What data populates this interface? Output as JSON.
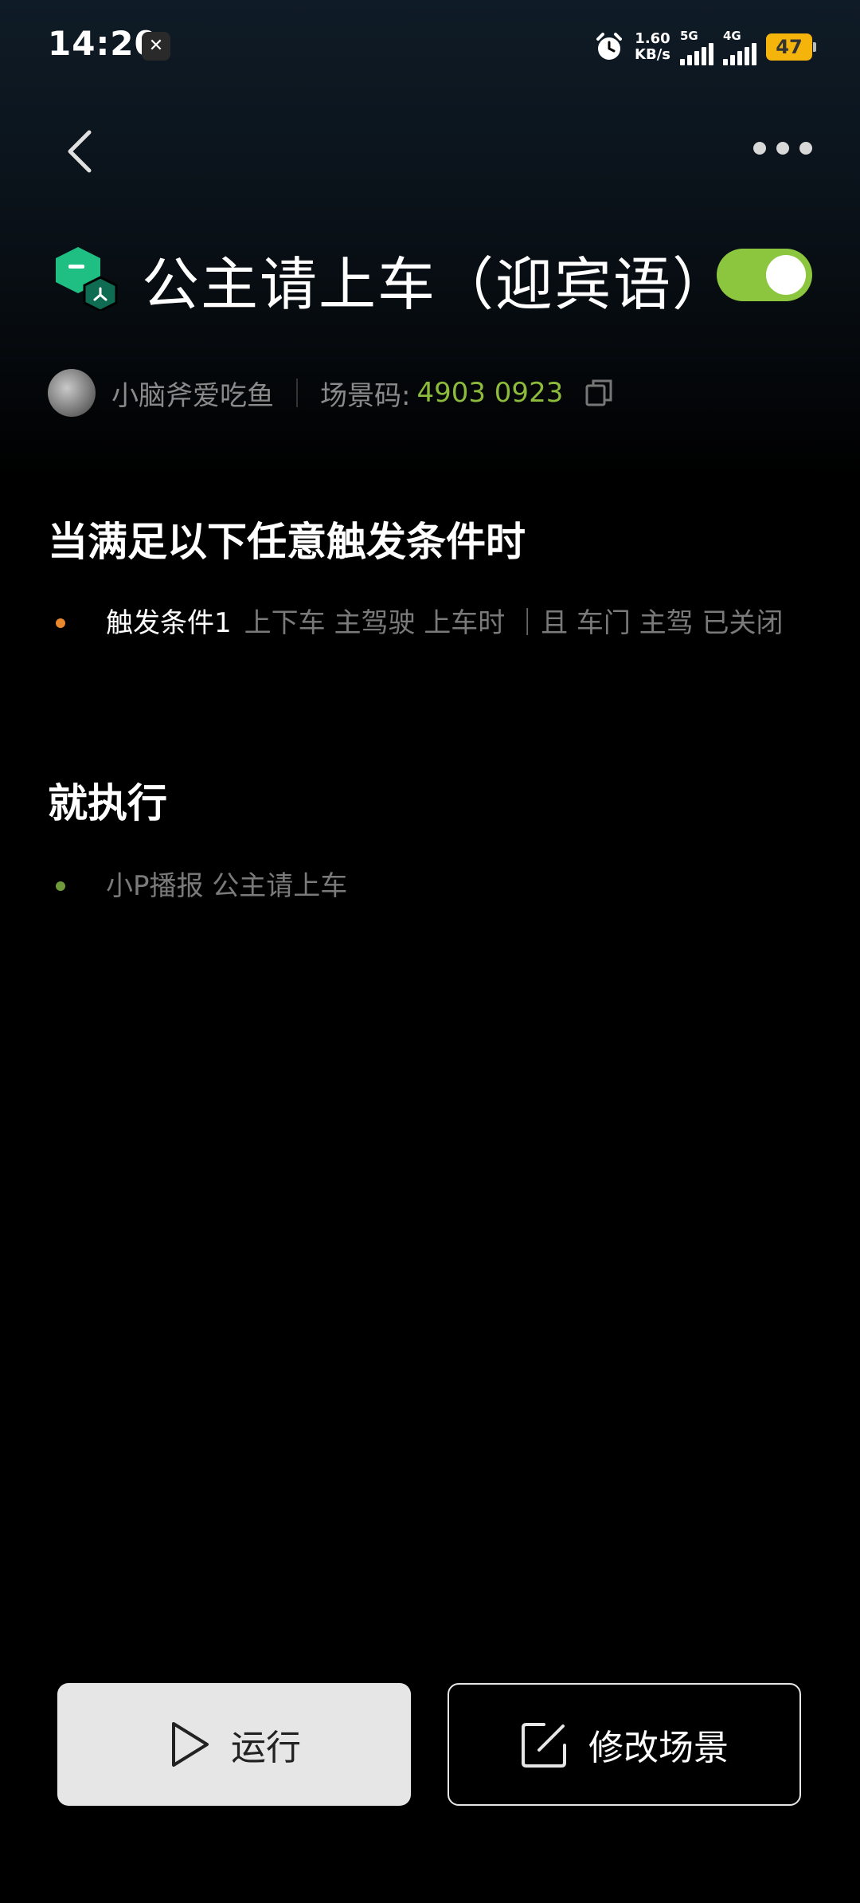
{
  "status_bar": {
    "time": "14:20",
    "net_speed_value": "1.60",
    "net_speed_unit": "KB/s",
    "signal1_label": "5G",
    "signal2_label": "4G",
    "battery": "47"
  },
  "header": {
    "title": "公主请上车（迎宾语）",
    "enabled": true
  },
  "author": {
    "name": "小脑斧爱吃鱼",
    "scene_code_label": "场景码:",
    "scene_code": "4903 0923"
  },
  "conditions": {
    "title": "当满足以下任意触发条件时",
    "items": [
      {
        "label": "触发条件1",
        "detail": "上下车 主驾驶 上车时 ｜且 车门 主驾 已关闭"
      }
    ]
  },
  "actions": {
    "title": "就执行",
    "items": [
      {
        "text": "小P播报 公主请上车"
      }
    ]
  },
  "buttons": {
    "run": "运行",
    "edit": "修改场景"
  },
  "colors": {
    "accent_green": "#8cc63f",
    "code_green": "#8dbb3c",
    "condition_dot": "#e8892d",
    "action_dot": "#6f9a3a",
    "battery": "#f5b40c"
  }
}
